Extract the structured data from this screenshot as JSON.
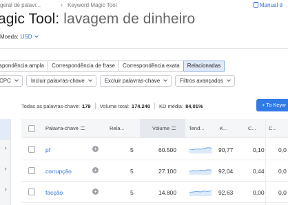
{
  "breadcrumb": {
    "parent": "geral de palavr...",
    "current": "Keyword Magic Tool",
    "manual": "Manual d"
  },
  "title": {
    "tool": "agic Tool:",
    "keyword": "lavagem de dinheiro"
  },
  "currency": {
    "label": "Moeda:",
    "value": "USD"
  },
  "match_tabs": [
    {
      "label": "spondência ampla",
      "active": false
    },
    {
      "label": "Correspondência de frase",
      "active": false
    },
    {
      "label": "Correspondência exata",
      "active": false
    },
    {
      "label": "Relacionadas",
      "active": true
    }
  ],
  "filters": [
    {
      "label": "CPC"
    },
    {
      "label": "Incluir palavras-chave"
    },
    {
      "label": "Excluir palavras-chave"
    },
    {
      "label": "Filtros avançados"
    }
  ],
  "summary": {
    "all_label": "Todas as palavras-chave:",
    "all_value": "179",
    "volume_label": "Volume total:",
    "volume_value": "174.240",
    "kd_label": "KD média:",
    "kd_value": "84,01%"
  },
  "add_button": {
    "label": "+ To Keyw"
  },
  "table": {
    "headers": {
      "keyword": "Palavra-chave",
      "related": "Rela...",
      "volume": "Volume",
      "trend": "Tend...",
      "kd": "K...",
      "cpc": "C...",
      "com": "C..."
    },
    "rows": [
      {
        "keyword": "pf",
        "related": "5",
        "volume": "60.500",
        "kd": "90,77",
        "cpc": "0,10",
        "com": "0,0",
        "trend": [
          0.5,
          0.45,
          0.55,
          0.5,
          0.6,
          0.7,
          0.65
        ]
      },
      {
        "keyword": "corrupção",
        "related": "5",
        "volume": "27.100",
        "kd": "92,04",
        "cpc": "0,44",
        "com": "0,0",
        "trend": [
          0.4,
          0.5,
          0.45,
          0.55,
          0.5,
          0.6,
          0.55
        ]
      },
      {
        "keyword": "facção",
        "related": "5",
        "volume": "14.800",
        "kd": "92,63",
        "com": "0,0",
        "cpc": "0,00",
        "trend": [
          0.45,
          0.5,
          0.55,
          0.5,
          0.6,
          0.55,
          0.65
        ]
      }
    ]
  },
  "colors": {
    "accent": "#2f6fd8",
    "button": "#2f7ae5",
    "active_tab": "#dfe9f8",
    "trend_line": "#6fa8e8"
  }
}
